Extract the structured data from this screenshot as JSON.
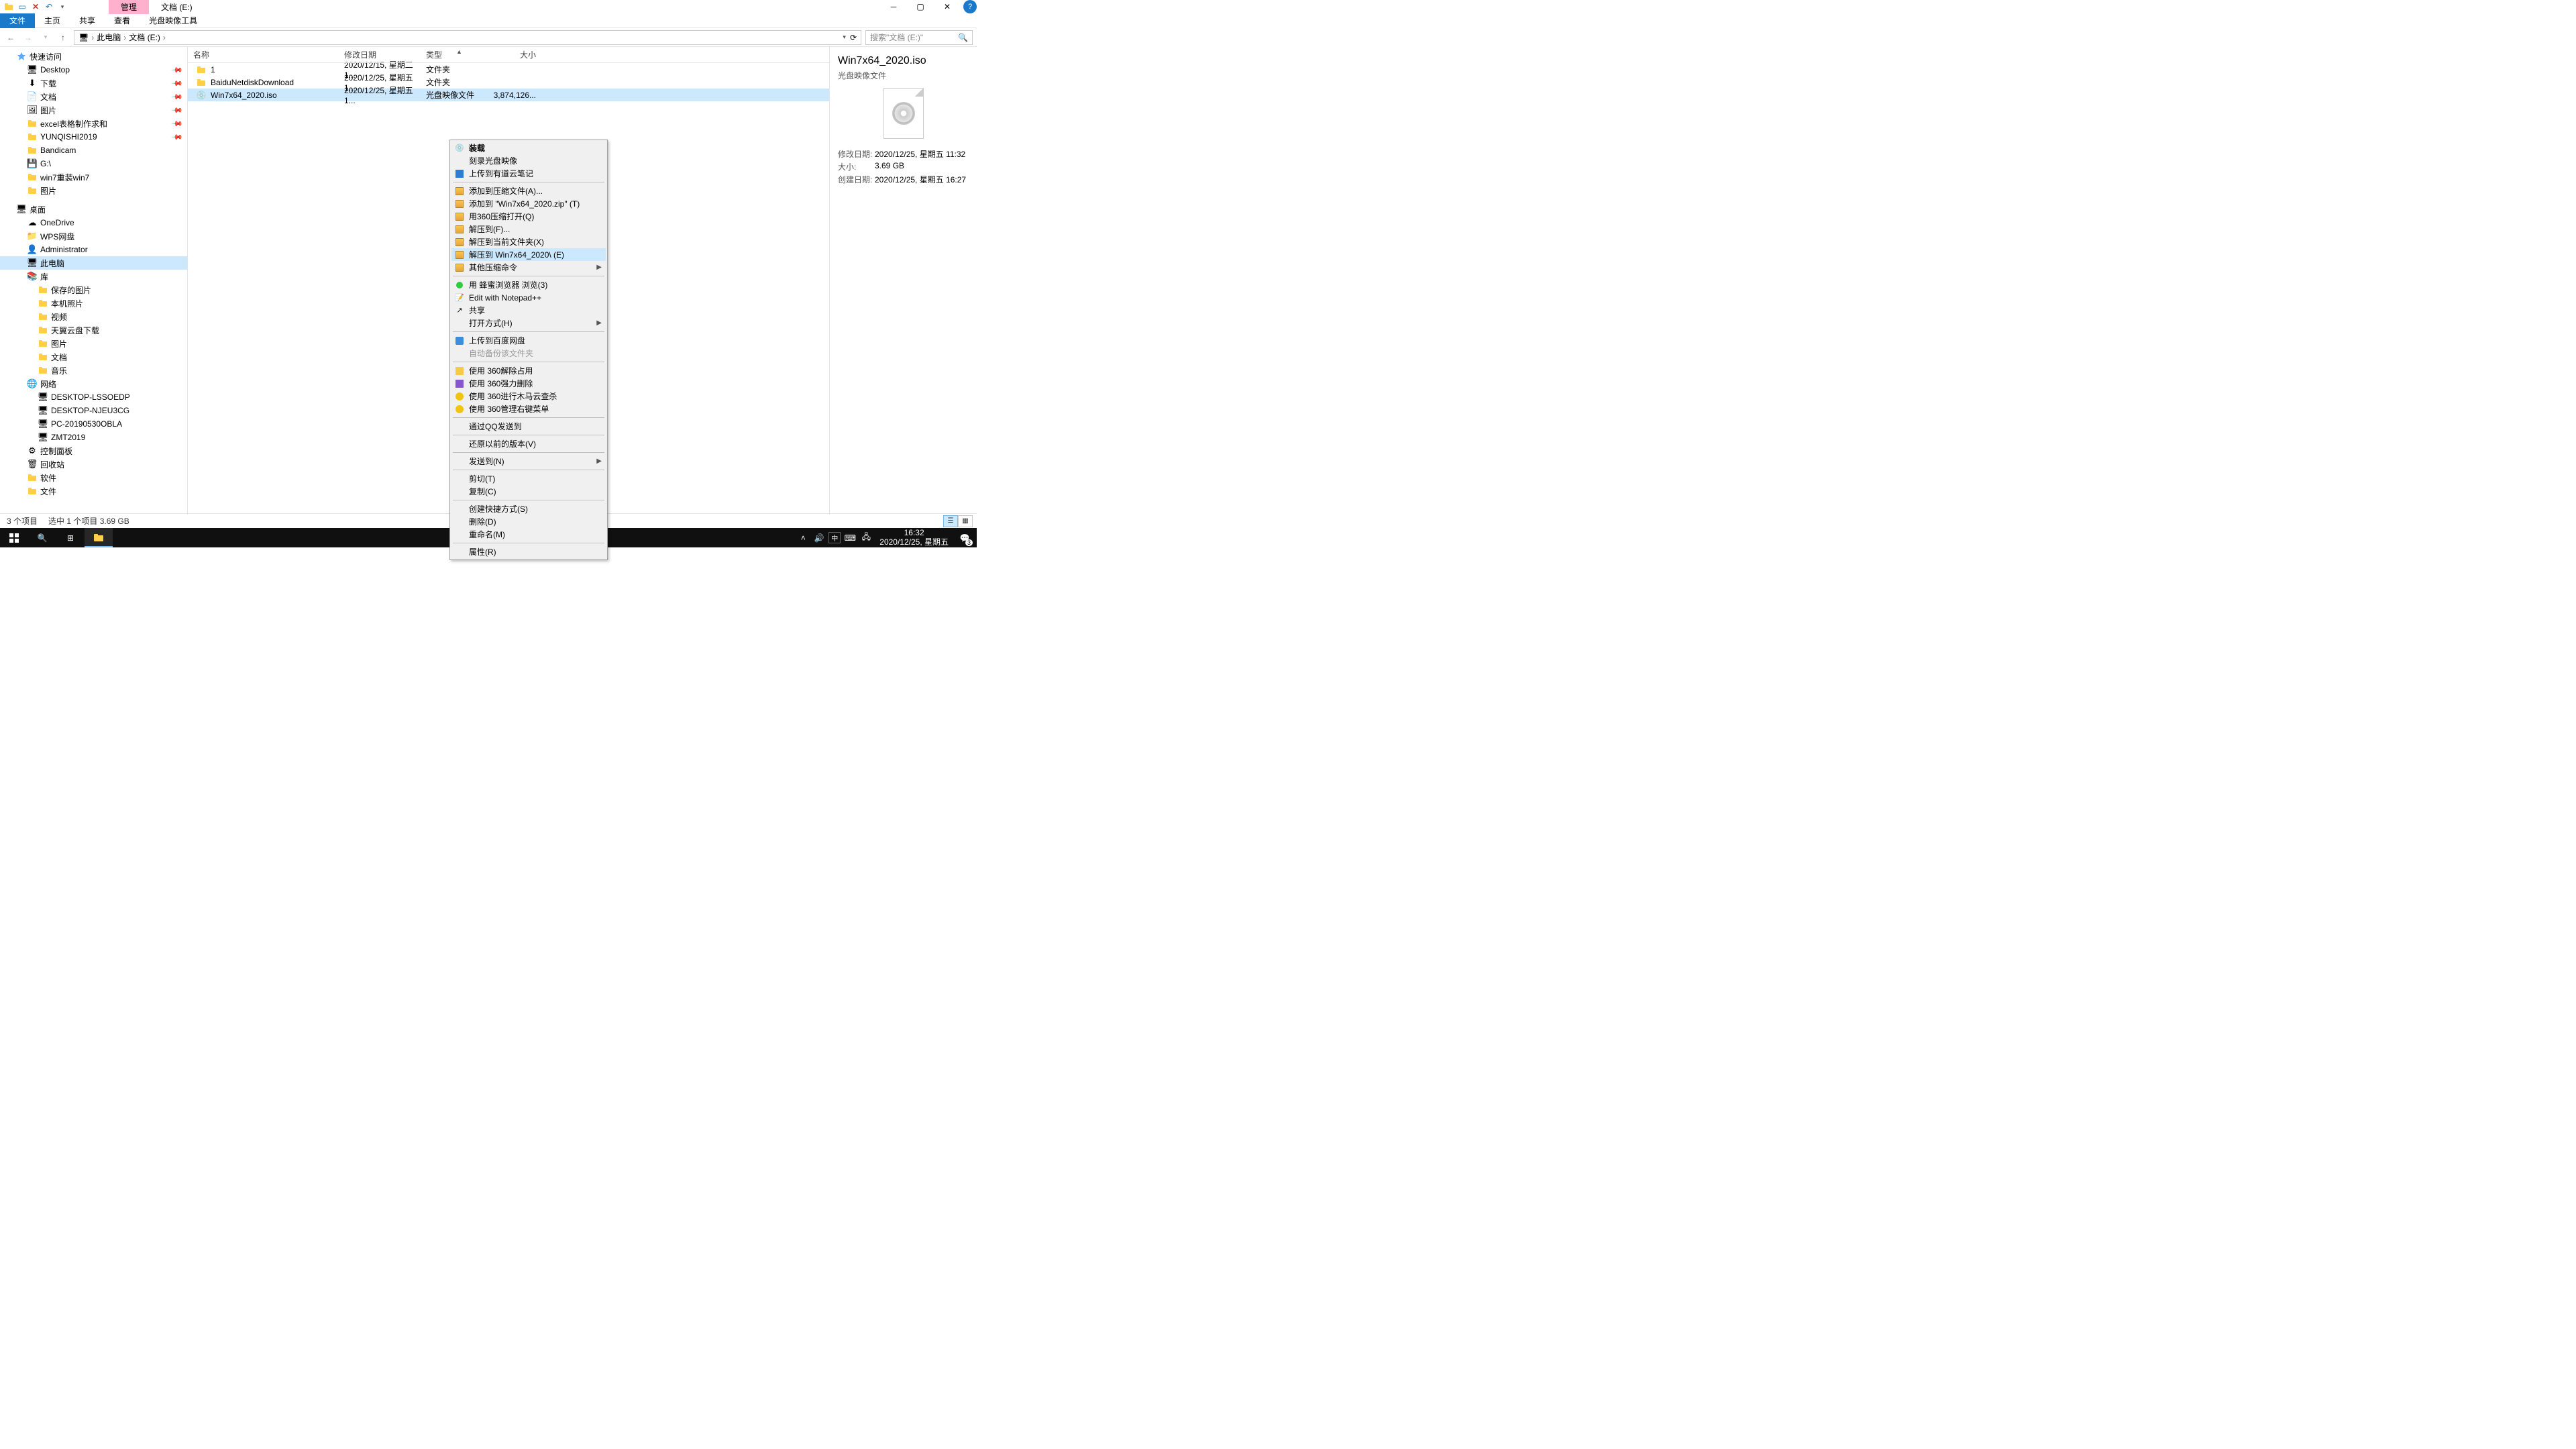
{
  "titlebar": {
    "tabs": [
      {
        "label": "管理",
        "active": true
      },
      {
        "label": "文档 (E:)",
        "active": false
      }
    ]
  },
  "ribbon": {
    "tabs": [
      {
        "label": "文件",
        "active": true
      },
      {
        "label": "主页"
      },
      {
        "label": "共享"
      },
      {
        "label": "查看"
      },
      {
        "label": "光盘映像工具"
      }
    ]
  },
  "breadcrumb": {
    "items": [
      "此电脑",
      "文档 (E:)"
    ]
  },
  "search": {
    "placeholder": "搜索\"文档 (E:)\""
  },
  "sidebar": {
    "groups": [
      {
        "type": "item",
        "icon": "star",
        "label": "快速访问",
        "indent": 1
      },
      {
        "type": "item",
        "icon": "monitor",
        "label": "Desktop",
        "indent": 2,
        "pin": true
      },
      {
        "type": "item",
        "icon": "download",
        "label": "下载",
        "indent": 2,
        "pin": true
      },
      {
        "type": "item",
        "icon": "doc",
        "label": "文档",
        "indent": 2,
        "pin": true
      },
      {
        "type": "item",
        "icon": "pic",
        "label": "图片",
        "indent": 2,
        "pin": true
      },
      {
        "type": "item",
        "icon": "folder",
        "label": "excel表格制作求和",
        "indent": 2,
        "pin": true
      },
      {
        "type": "item",
        "icon": "folder",
        "label": "YUNQISHI2019",
        "indent": 2,
        "pin": true
      },
      {
        "type": "item",
        "icon": "folder",
        "label": "Bandicam",
        "indent": 2
      },
      {
        "type": "item",
        "icon": "drive",
        "label": "G:\\",
        "indent": 2
      },
      {
        "type": "item",
        "icon": "folder",
        "label": "win7重装win7",
        "indent": 2
      },
      {
        "type": "item",
        "icon": "folder",
        "label": "图片",
        "indent": 2
      },
      {
        "type": "spacer"
      },
      {
        "type": "item",
        "icon": "monitor",
        "label": "桌面",
        "indent": 1
      },
      {
        "type": "item",
        "icon": "cloud",
        "label": "OneDrive",
        "indent": 2
      },
      {
        "type": "item",
        "icon": "wps",
        "label": "WPS网盘",
        "indent": 2
      },
      {
        "type": "item",
        "icon": "user",
        "label": "Administrator",
        "indent": 2
      },
      {
        "type": "item",
        "icon": "pc",
        "label": "此电脑",
        "indent": 2,
        "selected": true
      },
      {
        "type": "item",
        "icon": "lib",
        "label": "库",
        "indent": 2
      },
      {
        "type": "item",
        "icon": "folder",
        "label": "保存的图片",
        "indent": 3
      },
      {
        "type": "item",
        "icon": "folder",
        "label": "本机照片",
        "indent": 3
      },
      {
        "type": "item",
        "icon": "folder",
        "label": "视频",
        "indent": 3
      },
      {
        "type": "item",
        "icon": "folder",
        "label": "天翼云盘下载",
        "indent": 3
      },
      {
        "type": "item",
        "icon": "folder",
        "label": "图片",
        "indent": 3
      },
      {
        "type": "item",
        "icon": "folder",
        "label": "文档",
        "indent": 3
      },
      {
        "type": "item",
        "icon": "folder",
        "label": "音乐",
        "indent": 3
      },
      {
        "type": "item",
        "icon": "net",
        "label": "网络",
        "indent": 2
      },
      {
        "type": "item",
        "icon": "pc",
        "label": "DESKTOP-LSSOEDP",
        "indent": 3
      },
      {
        "type": "item",
        "icon": "pc",
        "label": "DESKTOP-NJEU3CG",
        "indent": 3
      },
      {
        "type": "item",
        "icon": "pc",
        "label": "PC-20190530OBLA",
        "indent": 3
      },
      {
        "type": "item",
        "icon": "pc",
        "label": "ZMT2019",
        "indent": 3
      },
      {
        "type": "item",
        "icon": "panel",
        "label": "控制面板",
        "indent": 2
      },
      {
        "type": "item",
        "icon": "bin",
        "label": "回收站",
        "indent": 2
      },
      {
        "type": "item",
        "icon": "folder",
        "label": "软件",
        "indent": 2
      },
      {
        "type": "item",
        "icon": "folder",
        "label": "文件",
        "indent": 2
      }
    ]
  },
  "columns": {
    "name": "名称",
    "date": "修改日期",
    "type": "类型",
    "size": "大小"
  },
  "files": [
    {
      "name": "1",
      "date": "2020/12/15, 星期二 1...",
      "type": "文件夹",
      "size": "",
      "icon": "folder"
    },
    {
      "name": "BaiduNetdiskDownload",
      "date": "2020/12/25, 星期五 1...",
      "type": "文件夹",
      "size": "",
      "icon": "folder"
    },
    {
      "name": "Win7x64_2020.iso",
      "date": "2020/12/25, 星期五 1...",
      "type": "光盘映像文件",
      "size": "3,874,126...",
      "icon": "iso",
      "selected": true
    }
  ],
  "context_menu": [
    {
      "icon": "disc",
      "label": "装载",
      "bold": true
    },
    {
      "label": "刻录光盘映像"
    },
    {
      "icon": "blue",
      "label": "上传到有道云笔记"
    },
    {
      "sep": true
    },
    {
      "icon": "archive",
      "label": "添加到压缩文件(A)..."
    },
    {
      "icon": "archive",
      "label": "添加到 \"Win7x64_2020.zip\" (T)"
    },
    {
      "icon": "archive",
      "label": "用360压缩打开(Q)"
    },
    {
      "icon": "archive",
      "label": "解压到(F)..."
    },
    {
      "icon": "archive",
      "label": "解压到当前文件夹(X)"
    },
    {
      "icon": "archive",
      "label": "解压到 Win7x64_2020\\ (E)",
      "hl": true
    },
    {
      "icon": "archive",
      "label": "其他压缩命令",
      "arrow": true
    },
    {
      "sep": true
    },
    {
      "icon": "green",
      "label": "用 蜂蜜浏览器 浏览(3)"
    },
    {
      "icon": "npp",
      "label": "Edit with Notepad++"
    },
    {
      "icon": "share",
      "label": "共享"
    },
    {
      "label": "打开方式(H)",
      "arrow": true
    },
    {
      "sep": true
    },
    {
      "icon": "baidu",
      "label": "上传到百度网盘"
    },
    {
      "label": "自动备份该文件夹",
      "disabled": true
    },
    {
      "sep": true
    },
    {
      "icon": "yellow",
      "label": "使用 360解除占用"
    },
    {
      "icon": "purple",
      "label": "使用 360强力删除"
    },
    {
      "icon": "360",
      "label": "使用 360进行木马云查杀"
    },
    {
      "icon": "360",
      "label": "使用 360管理右键菜单"
    },
    {
      "sep": true
    },
    {
      "label": "通过QQ发送到"
    },
    {
      "sep": true
    },
    {
      "label": "还原以前的版本(V)"
    },
    {
      "sep": true
    },
    {
      "label": "发送到(N)",
      "arrow": true
    },
    {
      "sep": true
    },
    {
      "label": "剪切(T)"
    },
    {
      "label": "复制(C)"
    },
    {
      "sep": true
    },
    {
      "label": "创建快捷方式(S)"
    },
    {
      "label": "删除(D)"
    },
    {
      "label": "重命名(M)"
    },
    {
      "sep": true
    },
    {
      "label": "属性(R)"
    }
  ],
  "preview": {
    "title": "Win7x64_2020.iso",
    "type": "光盘映像文件",
    "rows": [
      {
        "label": "修改日期:",
        "value": "2020/12/25, 星期五 11:32"
      },
      {
        "label": "大小:",
        "value": "3.69 GB"
      },
      {
        "label": "创建日期:",
        "value": "2020/12/25, 星期五 16:27"
      }
    ]
  },
  "statusbar": {
    "count": "3 个项目",
    "selection": "选中 1 个项目  3.69 GB"
  },
  "taskbar": {
    "time": "16:32",
    "date": "2020/12/25, 星期五",
    "ime": "中",
    "notif_count": "3"
  }
}
